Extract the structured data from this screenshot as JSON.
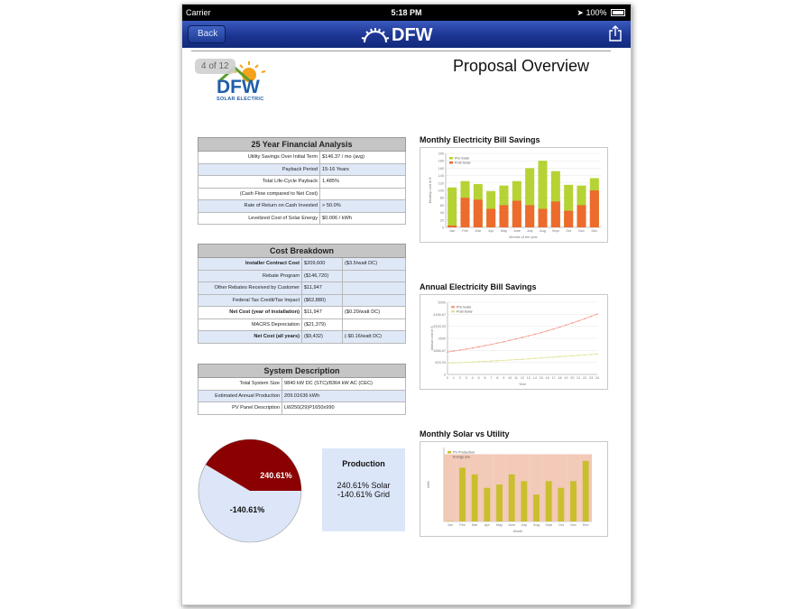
{
  "status": {
    "carrier": "Carrier",
    "time": "5:18 PM",
    "battery": "100%"
  },
  "nav": {
    "back_label": "Back",
    "logo_text": "DFW"
  },
  "page": {
    "counter": "4 of 12",
    "title": "Proposal Overview",
    "logo_text": "DFW",
    "logo_sub": "SOLAR ELECTRIC"
  },
  "financial": {
    "title": "25 Year Financial Analysis",
    "rows": [
      {
        "label": "Utility Savings Over Initial Term",
        "value": "$146.37 / mo (avg)"
      },
      {
        "label": "Payback Period",
        "value": "15-16 Years"
      },
      {
        "label": "Total Life-Cycle Payback",
        "value": "1,485%"
      },
      {
        "label": "(Cash Flow compared to Net Cost)",
        "value": ""
      },
      {
        "label": "Rate of Return on Cash Invested",
        "value": "> 50.0%"
      },
      {
        "label": "Levelized Cost of Solar Energy",
        "value": "$0.006 / kWh"
      }
    ]
  },
  "cost": {
    "title": "Cost Breakdown",
    "rows": [
      {
        "label": "Installer Contract Cost",
        "value": "$209,600",
        "note": "($3.5/watt DC)"
      },
      {
        "label": "Rebate Program",
        "value": "($146,720)",
        "note": ""
      },
      {
        "label": "Other Rebates Received by Customer",
        "value": "$11,947",
        "note": ""
      },
      {
        "label": "Federal Tax Credit/Tax Impact",
        "value": "($62,880)",
        "note": ""
      },
      {
        "label": "Net Cost (year of installation)",
        "value": "$11,947",
        "note": "($0.20/watt DC)"
      },
      {
        "label": "MACRS Depreciation",
        "value": "($21,379)",
        "note": ""
      },
      {
        "label": "Net Cost (all years)",
        "value": "($9,432)",
        "note": "(-$0.16/watt DC)"
      }
    ]
  },
  "system": {
    "title": "System Description",
    "rows": [
      {
        "label": "Total System Size",
        "value": "9840 kW DC (STC)/8364 kW AC (CEC)"
      },
      {
        "label": "Estimated Annual Production",
        "value": "209.01636 kWh"
      },
      {
        "label": "PV Panel Description",
        "value": "LW250(29)P1650x990"
      }
    ]
  },
  "pie": {
    "solar_label": "240.61%",
    "grid_label": "-140.61%",
    "solar_color": "#8b0000",
    "grid_color": "#dde6f8"
  },
  "production": {
    "title": "Production",
    "solar": "240.61% Solar",
    "grid": "-140.61% Grid"
  },
  "chart_data": [
    {
      "type": "bar",
      "title": "Monthly Electricity Bill Savings",
      "xlabel": "Months of the year",
      "ylabel": "Monthly cost in $",
      "categories": [
        "Jan",
        "Feb",
        "Mar",
        "Apr",
        "May",
        "June",
        "July",
        "Aug",
        "Sept",
        "Oct",
        "Nov",
        "Dec"
      ],
      "series": [
        {
          "name": "Pre-Solar",
          "color": "#b5d334",
          "values": [
            108,
            125,
            117,
            98,
            113,
            125,
            160,
            180,
            152,
            115,
            113,
            133
          ]
        },
        {
          "name": "Post-Solar",
          "color": "#ec6b2d",
          "values": [
            5,
            80,
            75,
            50,
            60,
            72,
            60,
            50,
            70,
            45,
            60,
            100
          ]
        }
      ],
      "ylim": [
        0,
        200
      ],
      "yticks": [
        0,
        20,
        40,
        60,
        80,
        100,
        120,
        140,
        160,
        180,
        200
      ],
      "legend": "top-left"
    },
    {
      "type": "line",
      "title": "Annual Electricity Bill Savings",
      "xlabel": "Year",
      "ylabel": "Annual cost in $",
      "x": [
        0,
        1,
        2,
        3,
        4,
        5,
        6,
        7,
        8,
        9,
        10,
        11,
        12,
        13,
        14,
        15,
        16,
        17,
        18,
        19,
        20,
        21,
        22,
        23,
        24
      ],
      "series": [
        {
          "name": "Pre-Solar",
          "color": "#f2a090",
          "values": [
            1550,
            1620,
            1690,
            1760,
            1830,
            1910,
            1990,
            2080,
            2170,
            2260,
            2360,
            2460,
            2560,
            2670,
            2780,
            2900,
            3020,
            3150,
            3280,
            3420,
            3560,
            3710,
            3860,
            4020,
            4180
          ]
        },
        {
          "name": "Post-Solar",
          "color": "#e2e59a",
          "values": [
            780,
            800,
            820,
            840,
            860,
            880,
            900,
            925,
            950,
            975,
            1000,
            1025,
            1050,
            1080,
            1110,
            1140,
            1170,
            1200,
            1230,
            1260,
            1290,
            1320,
            1350,
            1380,
            1410
          ]
        }
      ],
      "ylim": [
        0,
        5000
      ],
      "yticks": [
        "0",
        "833.33",
        "1666.67",
        "2500",
        "3333.33",
        "4166.67",
        "5000"
      ],
      "legend": "top-left"
    },
    {
      "type": "bar",
      "title": "Monthly Solar vs Utility",
      "xlabel": "Month",
      "ylabel": "kWh",
      "categories": [
        "Jan",
        "Feb",
        "Mar",
        "Apr",
        "May",
        "June",
        "July",
        "Aug",
        "Sept",
        "Oct",
        "Nov",
        "Dec"
      ],
      "series": [
        {
          "name": "PV Production",
          "color": "#c9bf2c",
          "values": [
            5,
            800,
            700,
            500,
            550,
            700,
            600,
            400,
            600,
            500,
            600,
            900
          ]
        },
        {
          "name": "Energy use",
          "color": "#f3c9b7",
          "values": [
            1000,
            1000,
            1000,
            1000,
            1000,
            1000,
            1000,
            1000,
            1000,
            1000,
            1000,
            1000
          ]
        }
      ],
      "ylim": [
        0,
        1100
      ],
      "legend": "top-left"
    }
  ]
}
